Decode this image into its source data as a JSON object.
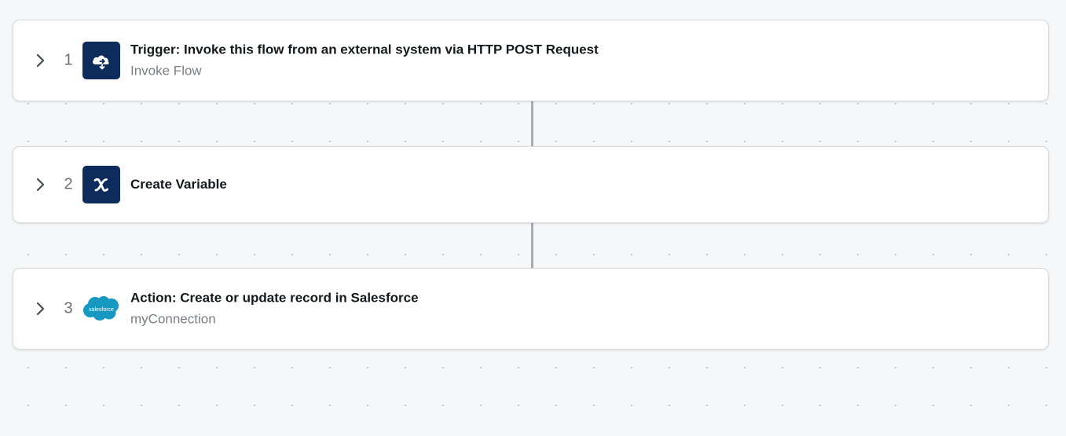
{
  "steps": [
    {
      "number": "1",
      "title": "Trigger: Invoke this flow from an external system via HTTP POST Request",
      "subtitle": "Invoke Flow",
      "icon": "cloud-invoke-icon"
    },
    {
      "number": "2",
      "title": "Create Variable",
      "subtitle": "",
      "icon": "variable-x-icon"
    },
    {
      "number": "3",
      "title": "Action: Create or update record in Salesforce",
      "subtitle": "myConnection",
      "icon": "salesforce-icon",
      "icon_text": "salesforce"
    }
  ],
  "colors": {
    "icon_bg": "#0e2c5b",
    "salesforce_blue": "#1798c1",
    "background": "#f6f7f9"
  }
}
